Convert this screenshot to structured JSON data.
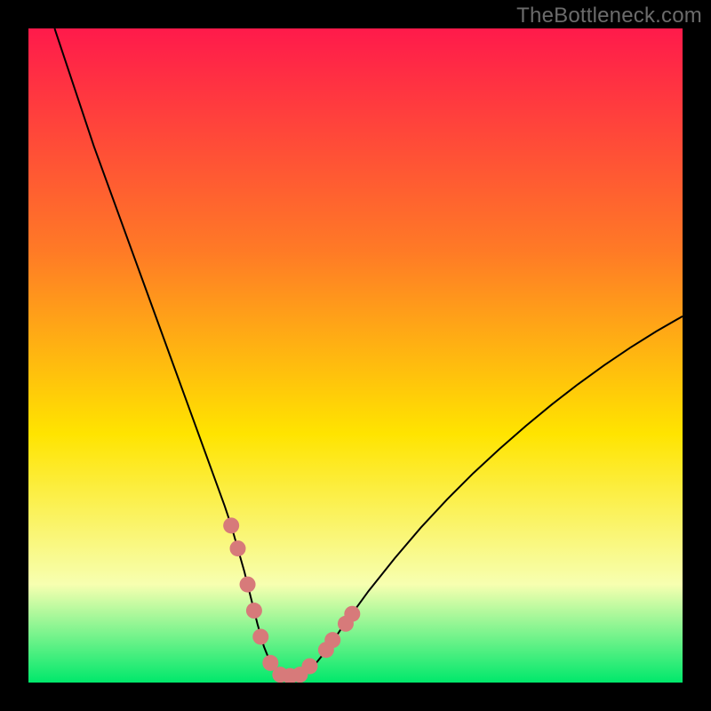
{
  "watermark": "TheBottleneck.com",
  "chart_data": {
    "type": "line",
    "title": "",
    "xlabel": "",
    "ylabel": "",
    "x_range": [
      0,
      100
    ],
    "y_range": [
      0,
      100
    ],
    "background_gradient": {
      "top": "#ff1a4b",
      "mid_upper": "#ff7a26",
      "mid": "#ffe400",
      "mid_lower": "#f7ffb0",
      "bottom": "#00e86b"
    },
    "series": [
      {
        "name": "bottleneck-curve",
        "color": "#000000",
        "stroke_width": 2,
        "x": [
          4,
          6,
          8,
          10,
          12,
          14,
          16,
          18,
          20,
          22,
          24,
          26,
          28,
          30,
          31,
          32,
          33,
          34,
          35,
          36,
          37,
          38,
          39,
          40,
          42,
          44,
          46,
          48,
          52,
          56,
          60,
          64,
          68,
          72,
          76,
          80,
          84,
          88,
          92,
          96,
          100
        ],
        "y": [
          100,
          94,
          88,
          82,
          76.5,
          71,
          65.5,
          60,
          54.5,
          49,
          43.5,
          38,
          32.5,
          27,
          24,
          20.5,
          17,
          13,
          9,
          5.5,
          3,
          1.5,
          1,
          1,
          1.5,
          3,
          5.5,
          8.5,
          14,
          19,
          23.7,
          28,
          32,
          35.7,
          39.2,
          42.5,
          45.6,
          48.5,
          51.2,
          53.7,
          56
        ]
      }
    ],
    "markers": {
      "name": "curve-bottom-markers",
      "color": "#d77a7a",
      "radius": 9,
      "points": [
        {
          "x": 31.0,
          "y": 24.0
        },
        {
          "x": 32.0,
          "y": 20.5
        },
        {
          "x": 33.5,
          "y": 15.0
        },
        {
          "x": 34.5,
          "y": 11.0
        },
        {
          "x": 35.5,
          "y": 7.0
        },
        {
          "x": 37.0,
          "y": 3.0
        },
        {
          "x": 38.5,
          "y": 1.2
        },
        {
          "x": 40.0,
          "y": 1.0
        },
        {
          "x": 41.5,
          "y": 1.2
        },
        {
          "x": 43.0,
          "y": 2.5
        },
        {
          "x": 45.5,
          "y": 5.0
        },
        {
          "x": 46.5,
          "y": 6.5
        },
        {
          "x": 48.5,
          "y": 9.0
        },
        {
          "x": 49.5,
          "y": 10.5
        }
      ]
    }
  }
}
